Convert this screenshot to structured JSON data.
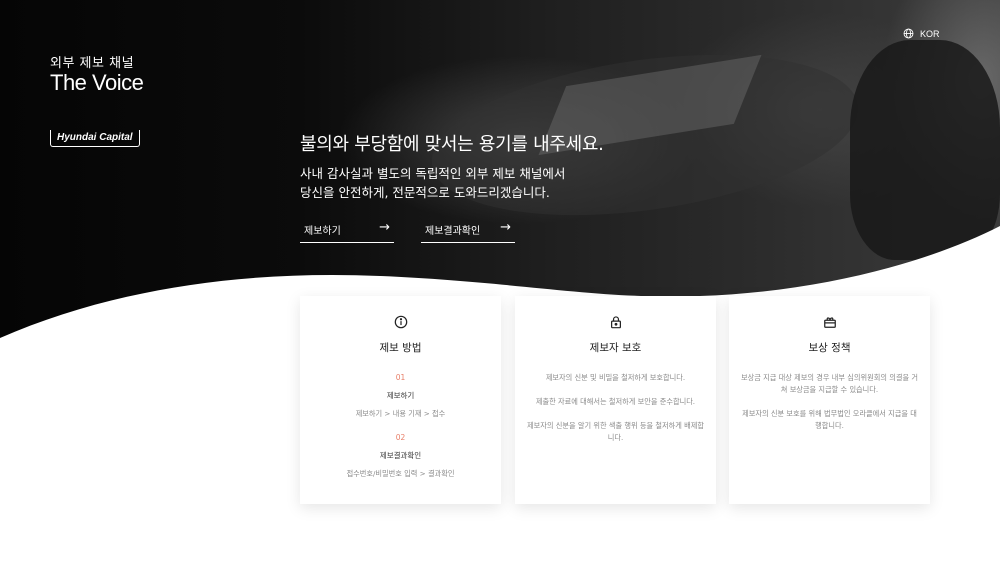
{
  "brand": {
    "subtitle": "외부 제보 채널",
    "title": "The Voice",
    "logo_text": "Hyundai Capital"
  },
  "language": {
    "label": "KOR",
    "icon": "globe-icon"
  },
  "hero": {
    "headline": "불의와 부당함에 맞서는 용기를 내주세요.",
    "description_line1": "사내 감사실과 별도의 독립적인 외부 제보 채널에서",
    "description_line2": "당신을 안전하게, 전문적으로 도와드리겠습니다."
  },
  "actions": [
    {
      "label": "제보하기",
      "arrow": "→"
    },
    {
      "label": "제보결과확인",
      "arrow": "→"
    }
  ],
  "cards": {
    "method": {
      "icon": "info-icon",
      "title": "제보 방법",
      "steps": [
        {
          "num": "01",
          "title": "제보하기",
          "path": "제보하기 > 내용 기재 > 접수"
        },
        {
          "num": "02",
          "title": "제보결과확인",
          "path": "접수번호/비밀번호 입력 > 결과확인"
        }
      ]
    },
    "protection": {
      "icon": "lock-icon",
      "title": "제보자 보호",
      "paragraphs": [
        "제보자의 신분 및 비밀을 철저하게 보호합니다.",
        "제출한 자료에 대해서는 철저하게 보안을 준수합니다.",
        "제보자의 신분을 알기 위한 색출 행위 등을 철저하게 배제합니다."
      ]
    },
    "reward": {
      "icon": "gift-icon",
      "title": "보상 정책",
      "paragraphs": [
        "보상금 지급 대상 제보의 경우 내부 심의위원회의 의결을 거쳐 보상금을 지급할 수 있습니다.",
        "제보자의 신분 보호를 위해 법무법인 오라클에서 지급을 대행합니다."
      ]
    }
  },
  "colors": {
    "accent": "#e8806a",
    "dark": "#0b0b0b",
    "muted_text": "#8a8a8a"
  }
}
